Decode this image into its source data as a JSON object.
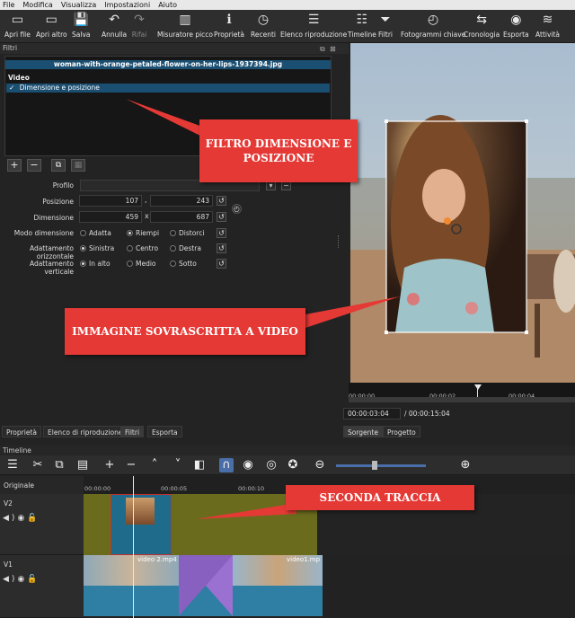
{
  "menu": [
    "File",
    "Modifica",
    "Visualizza",
    "Impostazioni",
    "Aiuto"
  ],
  "toolbar": [
    {
      "label": "Apri file",
      "icon": "open-file-icon",
      "glyph": "▭"
    },
    {
      "label": "Apri altro",
      "icon": "open-other-icon",
      "glyph": "▭"
    },
    {
      "label": "Salva",
      "icon": "save-icon",
      "glyph": "💾"
    },
    {
      "label": "Annulla",
      "icon": "undo-icon",
      "glyph": "↶"
    },
    {
      "label": "Rifai",
      "icon": "redo-icon",
      "glyph": "↷"
    },
    {
      "label": "Misuratore picco",
      "icon": "peak-meter-icon",
      "glyph": "▥"
    },
    {
      "label": "Proprietà",
      "icon": "info-icon",
      "glyph": "ℹ"
    },
    {
      "label": "Recenti",
      "icon": "clock-icon",
      "glyph": "◷"
    },
    {
      "label": "Elenco riproduzione",
      "icon": "list-icon",
      "glyph": "☰"
    },
    {
      "label": "Timeline",
      "icon": "timeline-icon",
      "glyph": "☷"
    },
    {
      "label": "Filtri",
      "icon": "funnel-icon",
      "glyph": "⏷"
    },
    {
      "label": "Fotogrammi chiave",
      "icon": "stopwatch-icon",
      "glyph": "◴"
    },
    {
      "label": "Cronologia",
      "icon": "history-icon",
      "glyph": "⇆"
    },
    {
      "label": "Esporta",
      "icon": "export-icon",
      "glyph": "◉"
    },
    {
      "label": "Attività",
      "icon": "jobs-icon",
      "glyph": "≋"
    }
  ],
  "filters": {
    "title": "Filtri",
    "file_name": "woman-with-orange-petaled-flower-on-her-lips-1937394.jpg",
    "section": "Video",
    "item_check": "✓",
    "item": "Dimensione e posizione"
  },
  "buttons": {
    "add": "+",
    "remove": "−",
    "copy": "⧉",
    "paste": "▦"
  },
  "params": {
    "profilo_label": "Profilo",
    "posizione_label": "Posizione",
    "pos_x": "107",
    "pos_sep": ",",
    "pos_y": "243",
    "dimensione_label": "Dimensione",
    "dim_w": "459",
    "dim_sep": "x",
    "dim_h": "687",
    "modo_label": "Modo dimensione",
    "modo_opts": [
      "Adatta",
      "Riempi",
      "Distorci"
    ],
    "oriz_label": "Adattamento orizzontale",
    "oriz_opts": [
      "Sinistra",
      "Centro",
      "Destra"
    ],
    "vert_label": "Adattamento verticale",
    "vert_opts": [
      "In alto",
      "Medio",
      "Sotto"
    ]
  },
  "preview": {
    "ruler_ticks": [
      "00:00:00",
      "00:00:02",
      "00:00:04"
    ],
    "timecode": "00:00:03:04",
    "duration": "/ 00:00:15:04"
  },
  "tabs_left": [
    "Proprietà",
    "Elenco di riproduzione",
    "Filtri",
    "Esporta"
  ],
  "tabs_right": [
    "Sorgente",
    "Progetto"
  ],
  "timeline": {
    "title": "Timeline",
    "header": "Originale",
    "ticks": [
      "00:00:00",
      "00:00:05",
      "00:00:10"
    ],
    "tracks": [
      {
        "name": "V2"
      },
      {
        "name": "V1"
      }
    ],
    "clips": {
      "v1_a": "video 2.mp4",
      "v1_b": "video1.mp"
    }
  },
  "annotations": {
    "filtro": "FILTRO DIMENSIONE E POSIZIONE",
    "immagine": "IMMAGINE SOVRASCRITTA A VIDEO",
    "traccia": "SECONDA TRACCIA"
  },
  "colors": {
    "accent": "#1b4f72",
    "callout": "#e53935",
    "track_v2": "#6b6b1e",
    "clip_blue": "#2e7fa3"
  }
}
